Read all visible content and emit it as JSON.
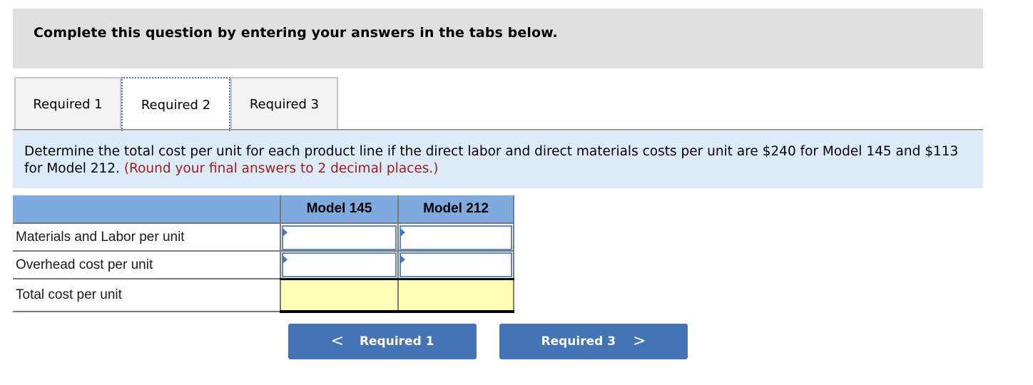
{
  "banner": {
    "text": "Complete this question by entering your answers in the tabs below."
  },
  "tabs": [
    {
      "label": "Required 1",
      "active": false
    },
    {
      "label": "Required 2",
      "active": true
    },
    {
      "label": "Required 3",
      "active": false
    }
  ],
  "instructions": {
    "text": "Determine the total cost per unit for each product line if the direct labor and direct materials costs per unit are $240 for Model 145 and $113 for Model 212.",
    "hint": "(Round your final answers to 2 decimal places.)"
  },
  "table": {
    "columns": [
      "",
      "Model 145",
      "Model 212"
    ],
    "rows": [
      {
        "label": "Materials and Labor per unit",
        "values": [
          "",
          ""
        ],
        "type": "input"
      },
      {
        "label": "Overhead cost per unit",
        "values": [
          "",
          ""
        ],
        "type": "input"
      },
      {
        "label": "Total cost per unit",
        "values": [
          "",
          ""
        ],
        "type": "computed"
      }
    ]
  },
  "navigation": {
    "prev": {
      "label": "Required 1",
      "icon": "chevron-left-icon",
      "glyph": "<"
    },
    "next": {
      "label": "Required 3",
      "icon": "chevron-right-icon",
      "glyph": ">"
    }
  },
  "colors": {
    "banner_bg": "#e0e0e0",
    "instructions_bg": "#ddebf8",
    "hint_text": "#a11d1d",
    "table_header_bg": "#7faadd",
    "input_border": "#5f89c4",
    "total_row_bg": "#fffdb7",
    "nav_button_bg": "#4574b4"
  }
}
